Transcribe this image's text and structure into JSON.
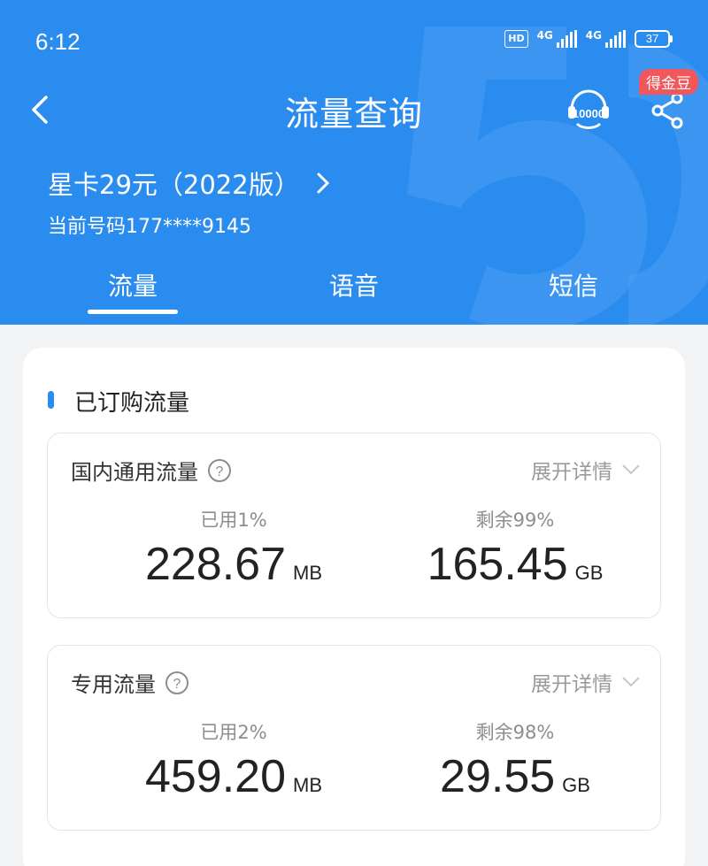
{
  "status_bar": {
    "time": "6:12",
    "hd_label": "HD",
    "signal1_label": "4G",
    "signal2_label": "4G",
    "battery": "37"
  },
  "nav": {
    "title": "流量查询",
    "service_icon_text": "10000",
    "coin_badge": "得金豆"
  },
  "plan": {
    "name": "星卡29元（2022版）",
    "current_number": "当前号码177****9145"
  },
  "tabs": [
    {
      "label": "流量",
      "active": true
    },
    {
      "label": "语音",
      "active": false
    },
    {
      "label": "短信",
      "active": false
    }
  ],
  "section": {
    "title": "已订购流量"
  },
  "expand_label": "展开详情",
  "data_boxes": [
    {
      "name": "国内通用流量",
      "used_label": "已用1%",
      "used_value": "228.67",
      "used_unit": "MB",
      "remaining_label": "剩余99%",
      "remaining_value": "165.45",
      "remaining_unit": "GB"
    },
    {
      "name": "专用流量",
      "used_label": "已用2%",
      "used_value": "459.20",
      "used_unit": "MB",
      "remaining_label": "剩余98%",
      "remaining_value": "29.55",
      "remaining_unit": "GB"
    }
  ],
  "colors": {
    "header_blue": "#2b8cf0",
    "badge_red": "#f2575b",
    "page_bg": "#f2f3f5"
  }
}
